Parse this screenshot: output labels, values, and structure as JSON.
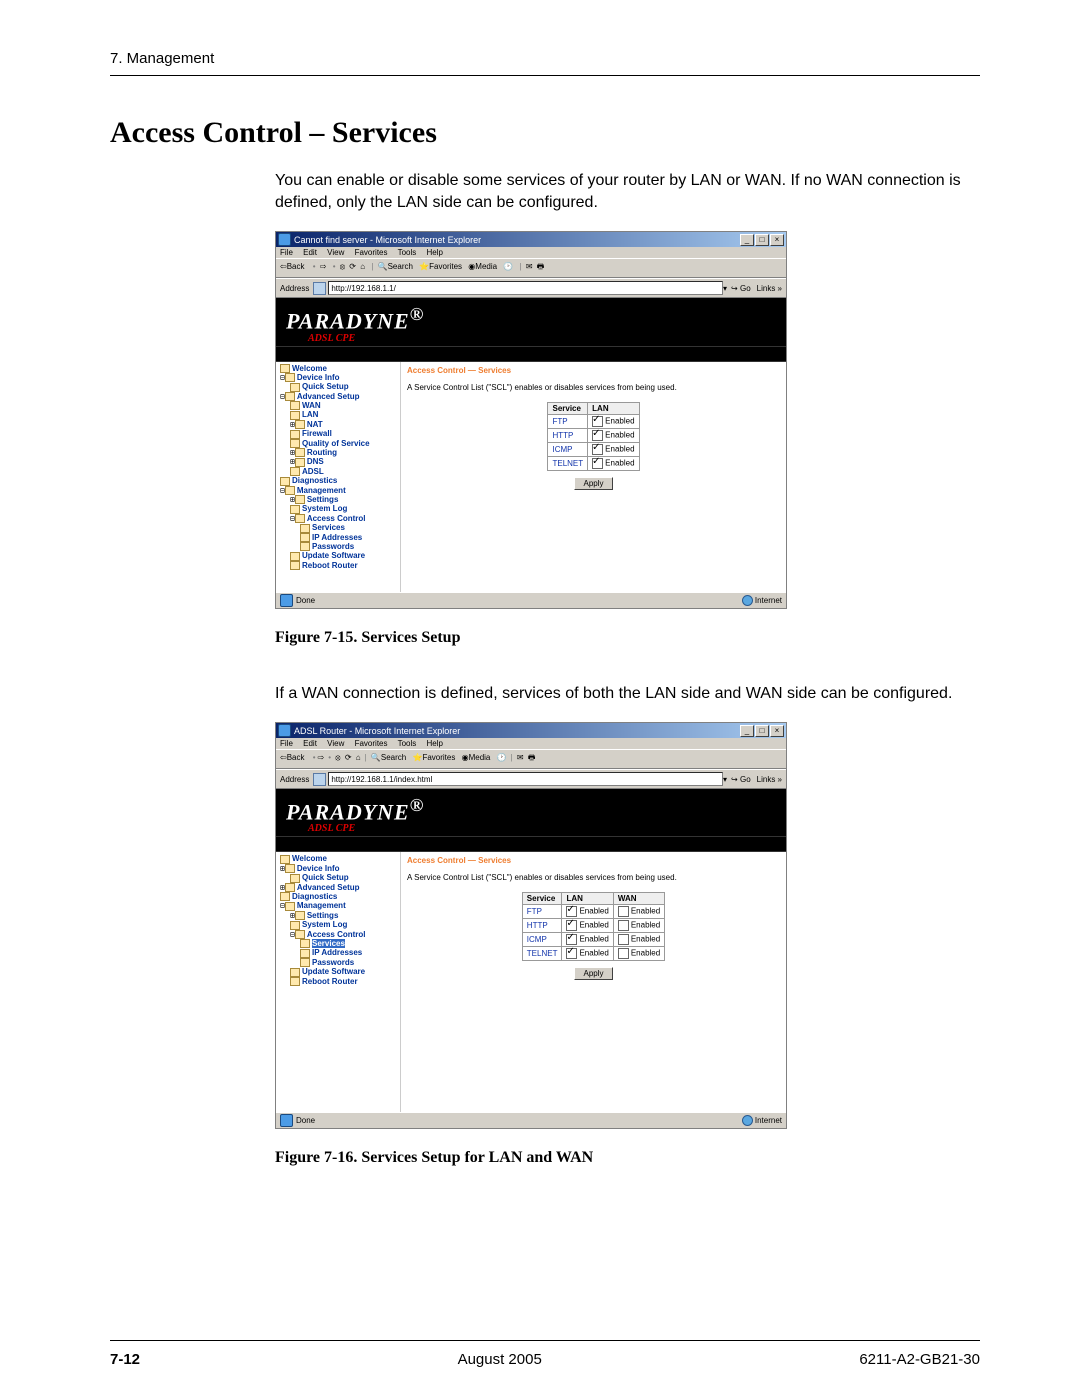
{
  "chapter_header": "7. Management",
  "section_title": "Access Control – Services",
  "intro_text": "You can enable or disable some services of your router by LAN or WAN. If no WAN connection is defined, only the LAN side can be configured.",
  "figure1_caption": "Figure 7-15.    Services Setup",
  "mid_text": "If a WAN connection is defined, services of both the LAN side and WAN side can be configured.",
  "figure2_caption": "Figure 7-16.    Services Setup for LAN and WAN",
  "footer": {
    "page": "7-12",
    "date": "August 2005",
    "docnum": "6211-A2-GB21-30"
  },
  "menubar": {
    "file": "File",
    "edit": "Edit",
    "view": "View",
    "favorites": "Favorites",
    "tools": "Tools",
    "help": "Help"
  },
  "toolbar": {
    "back": "Back",
    "search": "Search",
    "favs": "Favorites",
    "media": "Media"
  },
  "addr": {
    "label": "Address",
    "go": "Go",
    "links": "Links"
  },
  "brand": "PARADYNE",
  "brand_reg": "®",
  "brand_sub": "ADSL CPE",
  "pane": {
    "title": "Access Control — Services",
    "desc": "A Service Control List (\"SCL\") enables or disables services from being used.",
    "th_service": "Service",
    "th_lan": "LAN",
    "th_wan": "WAN",
    "enabled": "Enabled",
    "apply": "Apply"
  },
  "services": [
    "FTP",
    "HTTP",
    "ICMP",
    "TELNET"
  ],
  "status": {
    "done": "Done",
    "internet": "Internet"
  },
  "shot1": {
    "title": "Cannot find server - Microsoft Internet Explorer",
    "url": "http://192.168.1.1/",
    "nav": {
      "welcome": "Welcome",
      "device_info": "Device Info",
      "quick_setup": "Quick Setup",
      "advanced": "Advanced Setup",
      "wan": "WAN",
      "lan": "LAN",
      "nat": "NAT",
      "firewall": "Firewall",
      "qos": "Quality of Service",
      "routing": "Routing",
      "dns": "DNS",
      "adsl": "ADSL",
      "diagnostics": "Diagnostics",
      "management": "Management",
      "settings": "Settings",
      "syslog": "System Log",
      "access_control": "Access Control",
      "services": "Services",
      "ip_addresses": "IP Addresses",
      "passwords": "Passwords",
      "update_sw": "Update Software",
      "reboot": "Reboot Router"
    }
  },
  "shot2": {
    "title": "ADSL Router - Microsoft Internet Explorer",
    "url": "http://192.168.1.1/index.html",
    "nav": {
      "welcome": "Welcome",
      "device_info": "Device Info",
      "quick_setup": "Quick Setup",
      "advanced": "Advanced Setup",
      "diagnostics": "Diagnostics",
      "management": "Management",
      "settings": "Settings",
      "syslog": "System Log",
      "access_control": "Access Control",
      "services": "Services",
      "ip_addresses": "IP Addresses",
      "passwords": "Passwords",
      "update_sw": "Update Software",
      "reboot": "Reboot Router"
    },
    "lan_checked": [
      true,
      true,
      true,
      true
    ],
    "wan_checked": [
      false,
      false,
      false,
      false
    ]
  }
}
